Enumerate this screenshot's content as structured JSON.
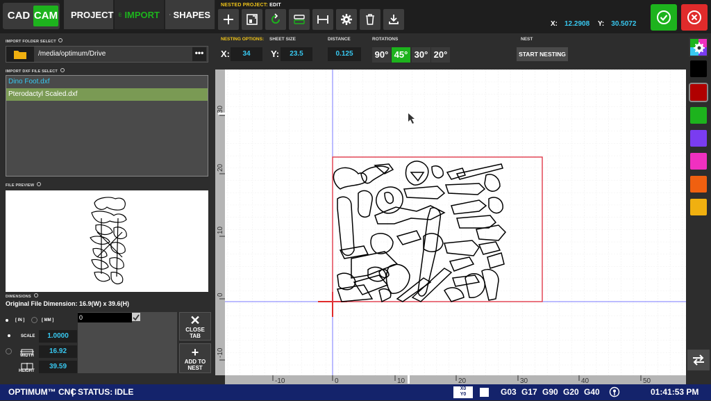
{
  "header": {
    "cad_label": "CAD",
    "cam_label": "CAM",
    "project_label": "PROJECT",
    "import_label": "IMPORT",
    "shapes_label": "SHAPES",
    "nested_project_label": "NESTED PROJECT:",
    "nested_project_mode": "EDIT",
    "x_label": "X:",
    "x_value": "12.2908",
    "y_label": "Y:",
    "y_value": "30.5072"
  },
  "left_panel": {
    "folder_select_label": "IMPORT FOLDER SELECT",
    "folder_path": "/media/optimum/Drive",
    "file_select_label": "IMPORT DXF FILE SELECT",
    "files": [
      "Dino Foot.dxf",
      "Pterodactyl Scaled.dxf"
    ],
    "file_preview_label": "FILE PREVIEW",
    "dimensions_label": "DIMENSIONS",
    "original_dimension": "Original File Dimension: 16.9(W) x 39.6(H)",
    "unit_in": "[ IN ]",
    "unit_mm": "[ MM ]",
    "scale_label": "SCALE",
    "scale_value": "1.0000",
    "width_label": "WIDTH",
    "width_value": "16.92",
    "height_label": "HEIGHT",
    "height_value": "39.59",
    "copies_value": "0",
    "close_tab_label": "CLOSE TAB",
    "add_to_nest_label": "ADD TO NEST"
  },
  "nesting": {
    "options_label": "NESTING OPTIONS:",
    "sheet_size_label": "SHEET SIZE",
    "x_label": "X:",
    "x_value": "34",
    "y_label": "Y:",
    "y_value": "23.5",
    "distance_label": "DISTANCE",
    "distance_value": "0.125",
    "rotations_label": "ROTATIONS",
    "rotations": [
      "90°",
      "45°",
      "30°",
      "20°"
    ],
    "active_rotation": "45°",
    "nest_label": "NEST",
    "start_nesting_label": "START NESTING"
  },
  "canvas": {
    "x_ticks": [
      "-10",
      "0",
      "10",
      "20",
      "30",
      "40",
      "50"
    ],
    "y_ticks": [
      "30",
      "20",
      "10",
      "0",
      "-10"
    ]
  },
  "colors": {
    "accent_green": "#1db31d",
    "danger_red": "#e02b2b",
    "value_cyan": "#38c8f0",
    "label_yellow": "#f0c419",
    "status_blue": "#14236b",
    "sheet_border": "#e03a4a",
    "swatches": [
      "#000000",
      "#b00000",
      "#1db31d",
      "#7a3cf0",
      "#f030c0",
      "#f06010",
      "#f0b010"
    ]
  },
  "status": {
    "brand": "OPTIMUM™ CNC",
    "separator": "|",
    "status_label": "STATUS:",
    "status_value": "IDLE",
    "codes": [
      "G03",
      "G17",
      "G90",
      "G20",
      "G40"
    ],
    "time": "01:41:53 PM"
  }
}
